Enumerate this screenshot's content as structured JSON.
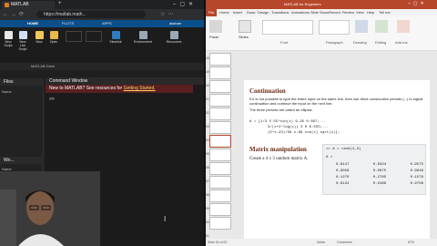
{
  "browser": {
    "tab_title": "MATLAB",
    "url": "https://matlab.math...",
    "user": "aksharr"
  },
  "matlab": {
    "tabs": [
      "HOME",
      "PLOTS",
      "APPS"
    ],
    "toolstrip": [
      "New Script",
      "New Live Script",
      "New",
      "Open",
      "Simulink",
      "Environment",
      "Resources"
    ],
    "path": "MATLAB Drive",
    "files_label": "Files",
    "name_label": "Name",
    "workspace_label": "Wo...",
    "name_label2": "Name",
    "command_window_title": "Command Window",
    "banner_text": "New to MATLAB? See resources for",
    "banner_link": "Getting Started.",
    "prompt": ">>"
  },
  "ppt": {
    "title_text": "MATLAB for Engineers",
    "menu_tabs": [
      "File",
      "Home",
      "Insert",
      "Draw",
      "Design",
      "Transitions",
      "Animations",
      "Slide Show",
      "Record",
      "Review",
      "View",
      "Help",
      "Tell me"
    ],
    "ribbon_groups": [
      "Paste",
      "Slides",
      "Font",
      "Paragraph",
      "Drawing",
      "Editing",
      "Add-ins"
    ],
    "thumb_numbers": [
      "48",
      "49",
      "50",
      "51",
      "52",
      "53",
      "54",
      "55",
      "56",
      "57",
      "58",
      "59",
      "60",
      "61"
    ],
    "slide": {
      "section_title": "Continuation",
      "para1": "If it is not possible to type the entire input on the same line, then use three consecutive periods (...) to signal continuation and continue the input on the next line.",
      "para2": "The three periods are called an ellipsis.",
      "code_line1": "A = [1/3   5.55*sin(x)   9.35   0.097;...",
      "code_line2": "3/(x+2*log(x))   3   0   6.555;...",
      "code_line3": "(5*x-23)/56   x-99   cos(x)   sqrt(x)];",
      "section2_title": "Matrix  manipulation",
      "task": "Create a 4 x 3 random matrix A.",
      "cmd": ">> A = rand(4,3)",
      "result_label": "A =",
      "matrix": [
        [
          "0.8147",
          "0.6324",
          "0.9575"
        ],
        [
          "0.9058",
          "0.0975",
          "0.9649"
        ],
        [
          "0.1270",
          "0.2785",
          "0.1576"
        ],
        [
          "0.9134",
          "0.5469",
          "0.9706"
        ]
      ]
    },
    "status": {
      "slide_info": "Slide 54 of 62",
      "notes": "Notes",
      "comments": "Comments",
      "zoom": "67%"
    }
  },
  "colors": {
    "matlab_blue": "#0b4f8a",
    "ppt_red": "#b7472a",
    "banner": "#5a1f1f"
  }
}
